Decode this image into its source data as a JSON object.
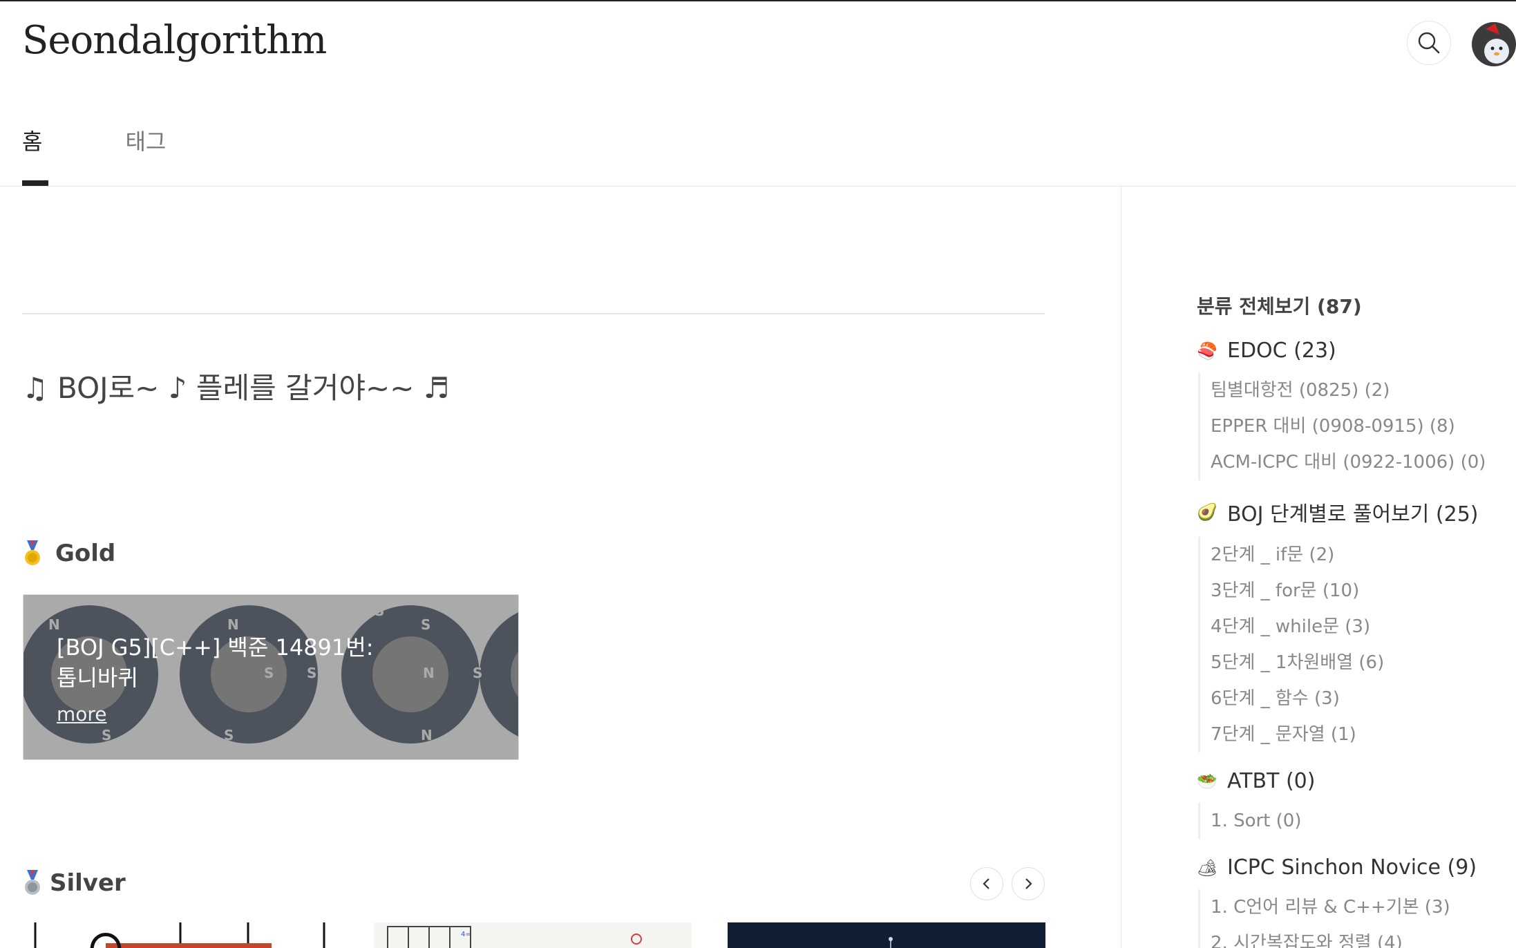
{
  "site": {
    "title": "Seondalgorithm"
  },
  "header": {
    "search_icon": "search-icon",
    "avatar_alt": "profile avatar"
  },
  "nav": {
    "tabs": [
      {
        "label": "홈",
        "active": true
      },
      {
        "label": "태그",
        "active": false
      }
    ]
  },
  "main": {
    "headline": "♫ BOJ로~ ♪ 플레를 갈거야~~ ♬",
    "sections": [
      {
        "icon": "gold-medal-icon",
        "title": "Gold",
        "cards": [
          {
            "title": "[BOJ G5][C++] 백준 14891번: 톱니바퀴",
            "more": "more"
          }
        ]
      },
      {
        "icon": "silver-medal-icon",
        "title": "Silver",
        "prev_icon": "chevron-left-icon",
        "next_icon": "chevron-right-icon"
      }
    ]
  },
  "sidebar": {
    "all_label": "분류 전체보기 (87)",
    "categories": [
      {
        "emoji": "🍣",
        "label": "EDOC (23)",
        "children": [
          "팀별대항전 (0825) (2)",
          "EPPER 대비 (0908-0915) (8)",
          "ACM-ICPC 대비 (0922-1006) (0)"
        ]
      },
      {
        "emoji": "🥑",
        "label": "BOJ 단계별로 풀어보기 (25)",
        "children": [
          "2단계 _ if문 (2)",
          "3단계 _ for문 (10)",
          "4단계 _ while문 (3)",
          "5단계 _ 1차원배열 (6)",
          "6단계 _ 함수 (3)",
          "7단계 _ 문자열 (1)"
        ]
      },
      {
        "emoji": "🥗",
        "label": "ATBT (0)",
        "children": [
          "1. Sort (0)"
        ]
      },
      {
        "emoji": "🏕",
        "label": "ICPC Sinchon Novice (9)",
        "children": [
          "1. C언어 리뷰 & C++기본 (3)",
          "2. 시간복잡도와 정렬 (4)"
        ]
      }
    ]
  },
  "colors": {
    "gear": "#2f3f55",
    "accent": "#222222",
    "muted": "#888888"
  }
}
